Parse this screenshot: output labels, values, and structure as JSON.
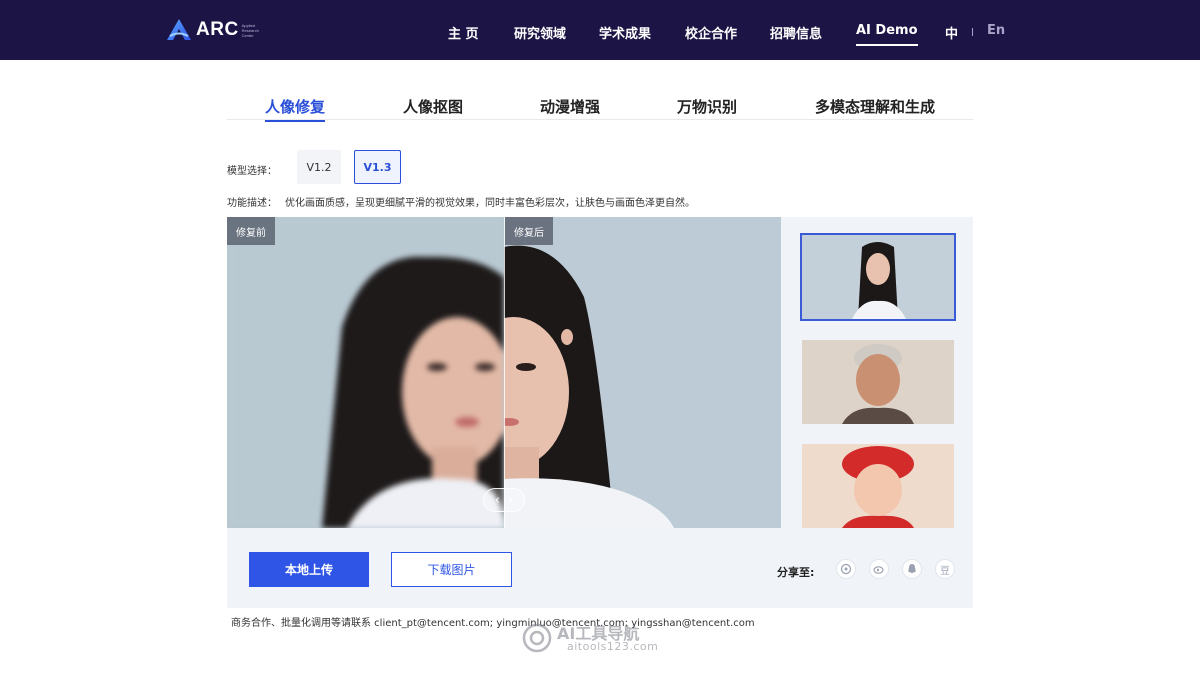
{
  "header": {
    "logo_text": "ARC",
    "logo_sub": "Applied Research Center",
    "nav": [
      {
        "label": "主 页"
      },
      {
        "label": "研究领域"
      },
      {
        "label": "学术成果"
      },
      {
        "label": "校企合作"
      },
      {
        "label": "招聘信息"
      },
      {
        "label": "AI Demo",
        "active": true
      }
    ],
    "lang_zh": "中",
    "lang_en": "En"
  },
  "tabs": [
    {
      "label": "人像修复",
      "active": true
    },
    {
      "label": "人像抠图"
    },
    {
      "label": "动漫增强"
    },
    {
      "label": "万物识别"
    },
    {
      "label": "多模态理解和生成"
    }
  ],
  "model": {
    "label": "模型选择：",
    "options": [
      "V1.2",
      "V1.3"
    ],
    "selected": "V1.3"
  },
  "description": {
    "label": "功能描述：",
    "text": "优化画面质感，呈现更细腻平滑的视觉效果，同时丰富色彩层次，让肤色与画面色泽更自然。"
  },
  "viewer": {
    "before_label": "修复前",
    "after_label": "修复后",
    "handle_left": "‹",
    "handle_right": "›"
  },
  "actions": {
    "upload": "本地上传",
    "download": "下载图片",
    "share_label": "分享至:",
    "share_douban": "豆"
  },
  "footer": {
    "contact": "商务合作、批量化调用等请联系 client_pt@tencent.com; yingminluo@tencent.com; yingsshan@tencent.com"
  },
  "watermark": {
    "title": "AI工具导航",
    "sub": "aitools123.com"
  },
  "colors": {
    "header_bg": "#1c1445",
    "accent": "#2e55e6",
    "panel_bg": "#f0f4f9"
  }
}
